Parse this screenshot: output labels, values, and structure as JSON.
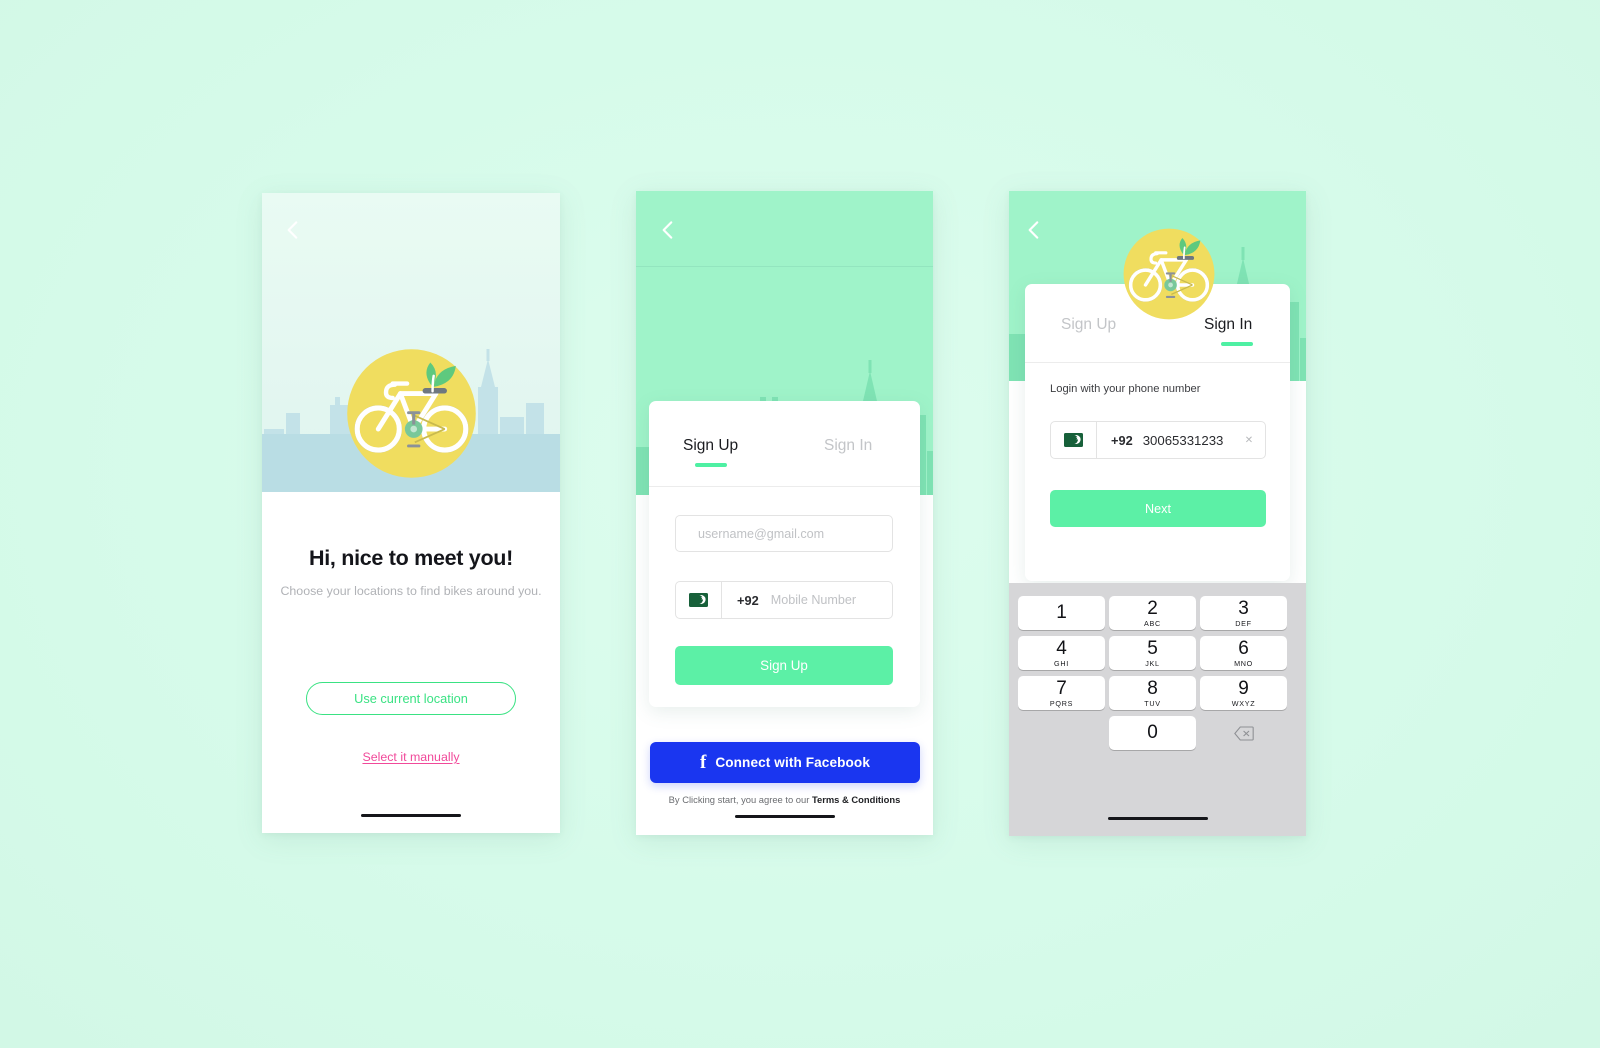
{
  "theme": {
    "page_background": "#d8fbea",
    "mint_header": "#9ff3c9",
    "accent_green": "#5cf0a6",
    "outline_green": "#3ae283",
    "pink_link": "#f1499a",
    "facebook_blue": "#1a36f0",
    "badge_yellow": "#f0dd5f",
    "ground_blue": "#b9dde4",
    "keypad_gray": "#d6d6d8"
  },
  "screen_location": {
    "back_icon": "chevron-left-icon",
    "logo_icon": "bicycle-leaf-badge-icon",
    "title": "Hi, nice to meet you!",
    "subtitle": "Choose your locations to find bikes around you.",
    "primary_button": "Use current location",
    "secondary_link": "Select it manually"
  },
  "screen_signup": {
    "back_icon": "chevron-left-icon",
    "logo_icon": "bicycle-leaf-badge-icon",
    "tabs": [
      {
        "label": "Sign Up",
        "active": true
      },
      {
        "label": "Sign In",
        "active": false
      }
    ],
    "email_placeholder": "username@gmail.com",
    "email_value": "",
    "country_flag": "pakistan-flag-icon",
    "dial_code": "+92",
    "phone_placeholder": "Mobile Number",
    "phone_value": "",
    "submit_button": "Sign Up",
    "facebook_button": "Connect with Facebook",
    "facebook_icon": "facebook-f-icon",
    "terms_prefix": "By Clicking start, you agree to our ",
    "terms_link": "Terms & Conditions"
  },
  "screen_signin": {
    "back_icon": "chevron-left-icon",
    "logo_icon": "bicycle-leaf-badge-icon",
    "tabs": [
      {
        "label": "Sign Up",
        "active": false
      },
      {
        "label": "Sign In",
        "active": true
      }
    ],
    "hint": "Login with your phone number",
    "country_flag": "pakistan-flag-icon",
    "dial_code": "+92",
    "phone_value": "30065331233",
    "clear_icon": "clear-circle-icon",
    "next_button": "Next",
    "keypad": {
      "keys": [
        {
          "num": "1",
          "letters": ""
        },
        {
          "num": "2",
          "letters": "ABC"
        },
        {
          "num": "3",
          "letters": "DEF"
        },
        {
          "num": "4",
          "letters": "GHI"
        },
        {
          "num": "5",
          "letters": "JKL"
        },
        {
          "num": "6",
          "letters": "MNO"
        },
        {
          "num": "7",
          "letters": "PQRS"
        },
        {
          "num": "8",
          "letters": "TUV"
        },
        {
          "num": "9",
          "letters": "WXYZ"
        },
        {
          "num": "0",
          "letters": ""
        }
      ],
      "backspace_icon": "backspace-icon"
    }
  }
}
